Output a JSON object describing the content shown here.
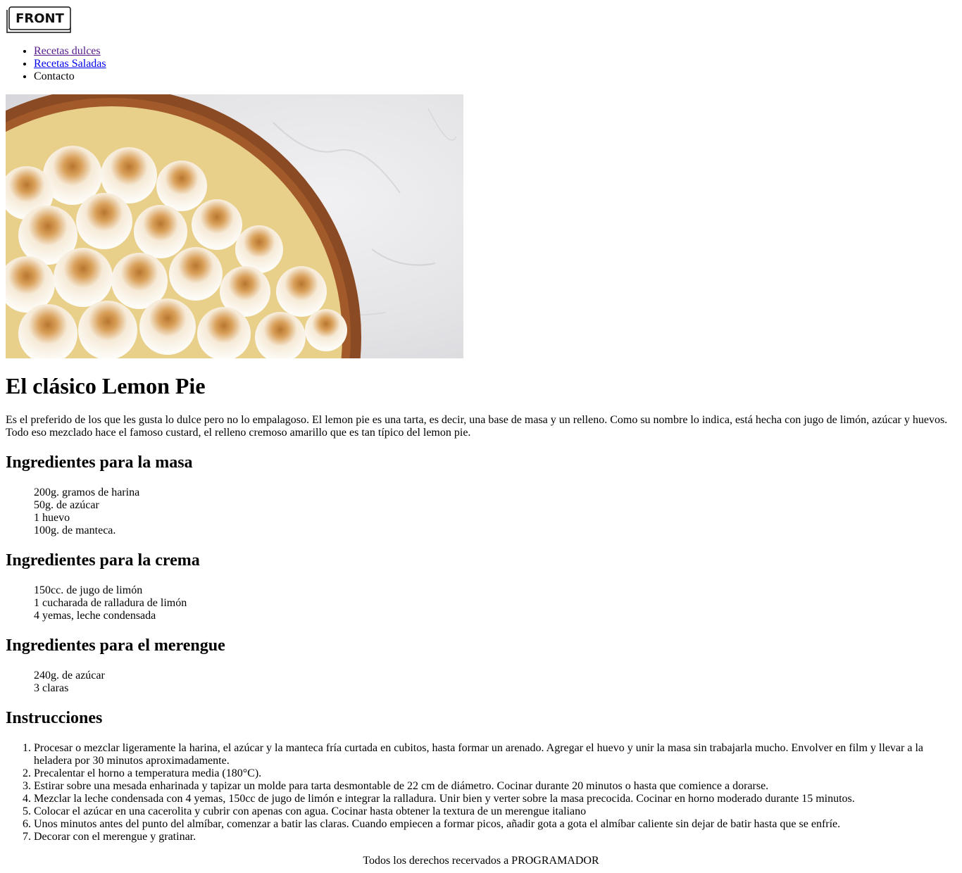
{
  "header": {
    "logo_text": "FRONT"
  },
  "nav": {
    "items": [
      {
        "label": "Recetas dulces"
      },
      {
        "label": "Recetas Saladas"
      },
      {
        "label": "Contacto"
      }
    ]
  },
  "article": {
    "title": "El clásico Lemon Pie",
    "intro": "Es el preferido de los que les gusta lo dulce pero no lo empalagoso. El lemon pie es una tarta, es decir, una base de masa y un relleno. Como su nombre lo indica, está hecha con jugo de limón, azúcar y huevos. Todo eso mezclado hace el famoso custard, el relleno cremoso amarillo que es tan típico del lemon pie.",
    "sections": [
      {
        "heading": "Ingredientes para la masa",
        "items": [
          "200g. gramos de harina",
          "50g. de azúcar",
          "1 huevo",
          "100g. de manteca."
        ]
      },
      {
        "heading": "Ingredientes para la crema",
        "items": [
          "150cc. de jugo de limón",
          "1 cucharada de ralladura de limón",
          "4 yemas, leche condensada"
        ]
      },
      {
        "heading": "Ingredientes para el merengue",
        "items": [
          "240g. de azúcar",
          "3 claras"
        ]
      }
    ],
    "instructions_heading": "Instrucciones",
    "steps": [
      "Procesar o mezclar ligeramente la harina, el azúcar y la manteca fría curtada en cubitos, hasta formar un arenado. Agregar el huevo y unir la masa sin trabajarla mucho. Envolver en film y llevar a la heladera por 30 minutos aproximadamente.",
      "Precalentar el horno a temperatura media (180°C).",
      "Estirar sobre una mesada enharinada y tapizar un molde para tarta desmontable de 22 cm de diámetro. Cocinar durante 20 minutos o hasta que comience a dorarse.",
      "Mezclar la leche condensada con 4 yemas, 150cc de jugo de limón e integrar la ralladura. Unir bien y verter sobre la masa precocida. Cocinar en horno moderado durante 15 minutos.",
      "Colocar el azúcar en una cacerolita y cubrir con apenas con agua. Cocinar hasta obtener la textura de un merengue italiano",
      "Unos minutos antes del punto del almíbar, comenzar a batir las claras. Cuando empiecen a formar picos, añadir gota a gota el almíbar caliente sin dejar de batir hasta que se enfríe.",
      "Decorar con el merengue y gratinar."
    ]
  },
  "footer": {
    "text": "Todos los derechos recervados a PROGRAMADOR"
  }
}
